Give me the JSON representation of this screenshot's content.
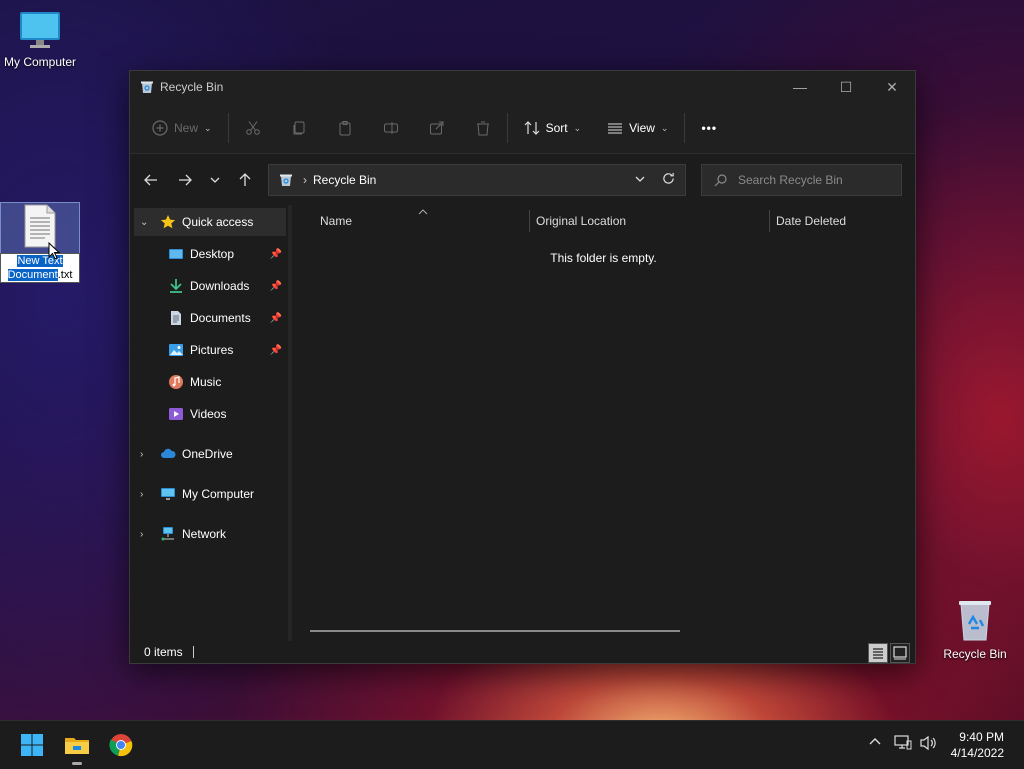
{
  "desktop": {
    "icons": [
      {
        "label": "My Computer"
      },
      {
        "label_selected": "New Text Document",
        "label_rest": ".txt"
      },
      {
        "label": "Recycle Bin"
      }
    ]
  },
  "window": {
    "title": "Recycle Bin",
    "controls": {
      "minimize": "—",
      "maximize": "☐",
      "close": "✕"
    },
    "toolbar": {
      "new_label": "New",
      "sort_label": "Sort",
      "view_label": "View",
      "more_label": "•••"
    },
    "address": {
      "path": "Recycle Bin"
    },
    "search": {
      "placeholder": "Search Recycle Bin"
    },
    "sidebar": {
      "quick_access": "Quick access",
      "items": [
        {
          "label": "Desktop",
          "pinned": true
        },
        {
          "label": "Downloads",
          "pinned": true
        },
        {
          "label": "Documents",
          "pinned": true
        },
        {
          "label": "Pictures",
          "pinned": true
        },
        {
          "label": "Music",
          "pinned": false
        },
        {
          "label": "Videos",
          "pinned": false
        }
      ],
      "groups": [
        {
          "label": "OneDrive"
        },
        {
          "label": "My Computer"
        },
        {
          "label": "Network"
        }
      ]
    },
    "columns": [
      "Name",
      "Original Location",
      "Date Deleted"
    ],
    "empty_message": "This folder is empty.",
    "status": {
      "item_count": "0 items"
    }
  },
  "taskbar": {
    "clock_time": "9:40 PM",
    "clock_date": "4/14/2022"
  },
  "colors": {
    "accent": "#0a64c8",
    "window_bg": "#1c1c1c",
    "taskbar_bg": "#1c1c1c"
  }
}
